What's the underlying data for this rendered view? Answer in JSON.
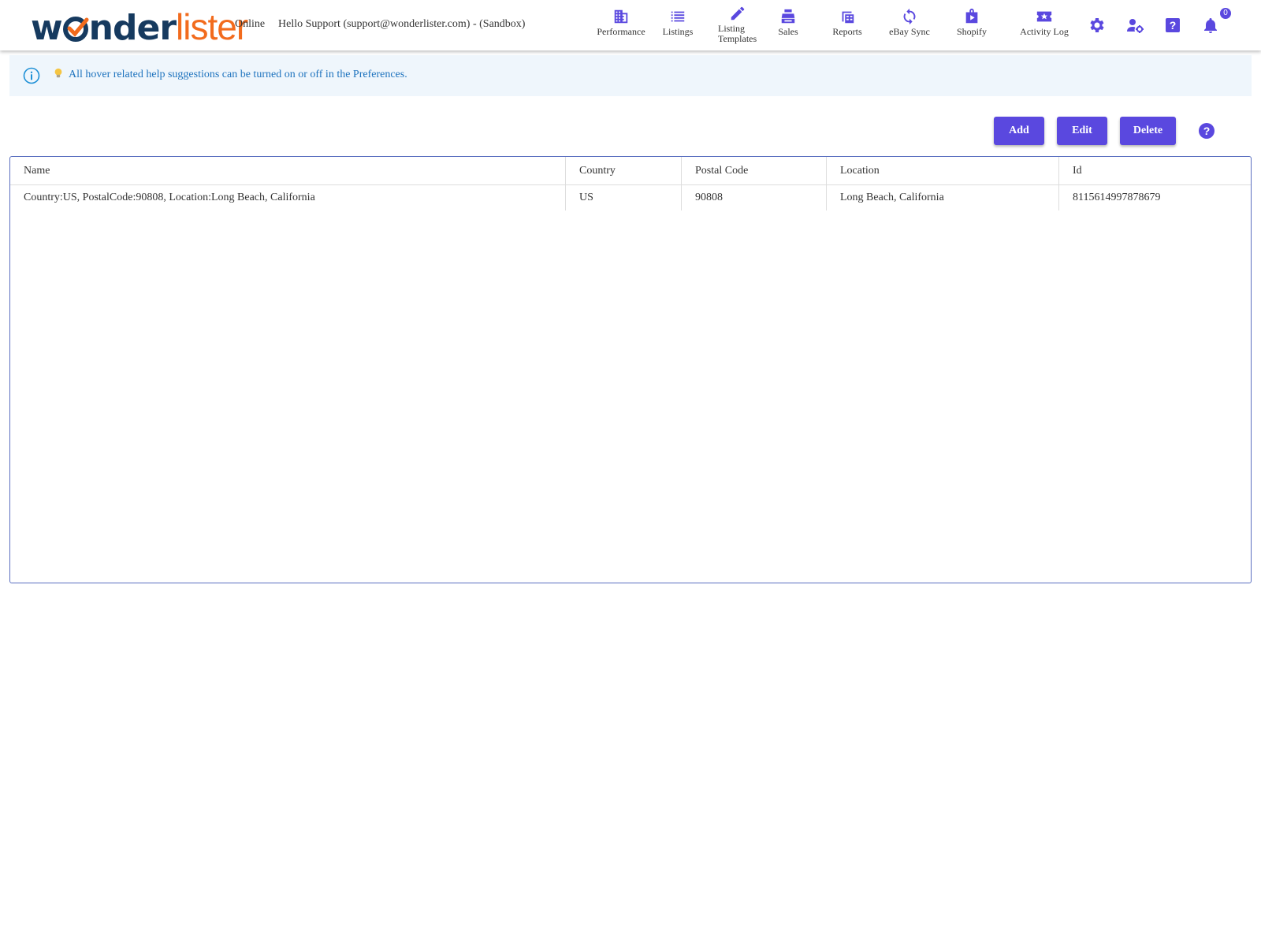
{
  "header": {
    "logo_w": "w",
    "logo_o": "o",
    "logo_nder": "nder",
    "logo_lister": "lister",
    "status": "Online",
    "greeting": "Hello Support (support@wonderlister.com) - (Sandbox)",
    "nav": [
      {
        "label": "Performance",
        "icon": "building-icon"
      },
      {
        "label": "Listings",
        "icon": "list-icon"
      },
      {
        "label": "Listing Templates",
        "icon": "pencil-icon"
      },
      {
        "label": "Sales",
        "icon": "cash-register-icon"
      },
      {
        "label": "Reports",
        "icon": "reports-icon"
      },
      {
        "label": "eBay Sync",
        "icon": "sync-icon"
      },
      {
        "label": "Shopify",
        "icon": "shopify-bag-icon"
      },
      {
        "label": "Activity Log",
        "icon": "star-ticket-icon"
      }
    ],
    "notification_count": "0"
  },
  "banner": {
    "message": "All hover related help suggestions can be turned on or off in the Preferences."
  },
  "toolbar": {
    "add_label": "Add",
    "edit_label": "Edit",
    "delete_label": "Delete"
  },
  "table": {
    "columns": [
      "Name",
      "Country",
      "Postal Code",
      "Location",
      "Id"
    ],
    "rows": [
      [
        "Country:US, PostalCode:90808, Location:Long Beach, California",
        "US",
        "90808",
        "Long Beach, California",
        "8115614997878679"
      ]
    ]
  },
  "colors": {
    "accent": "#5a48df",
    "logo_dark": "#163a5f",
    "logo_orange": "#f26b1d",
    "banner_bg": "#eff6fc",
    "banner_text": "#1e73be"
  }
}
